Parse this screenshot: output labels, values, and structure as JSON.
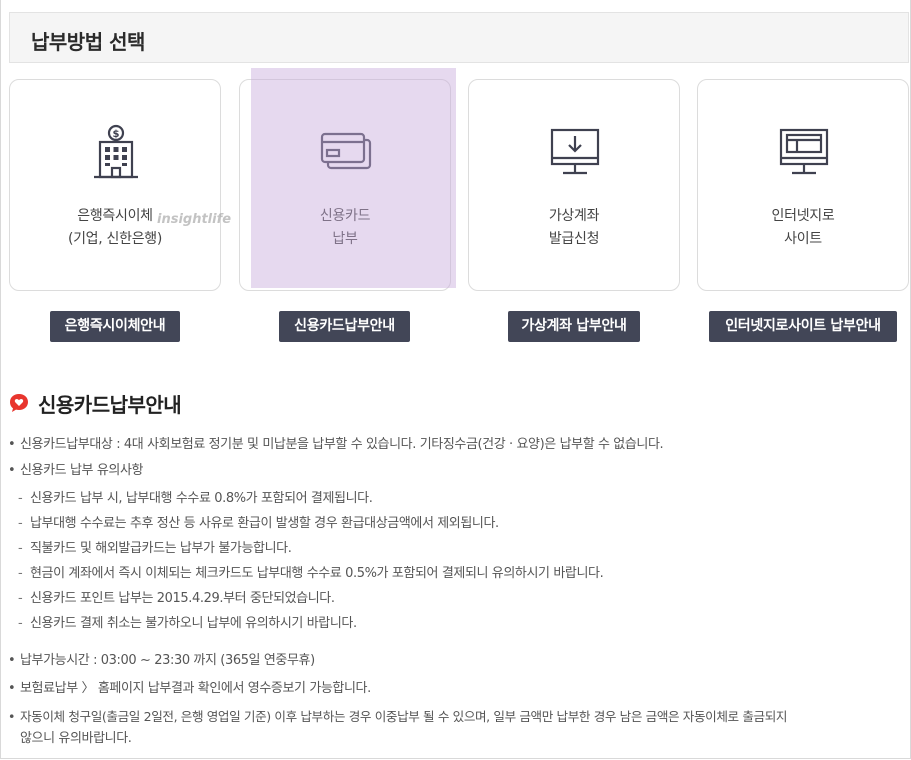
{
  "header": {
    "title": "납부방법 선택"
  },
  "cards": [
    {
      "line1": "은행즉시이체",
      "line2": "(기업, 신한은행)",
      "icon": "bank-building-icon"
    },
    {
      "line1": "신용카드",
      "line2": "납부",
      "icon": "credit-card-icon"
    },
    {
      "line1": "가상계좌",
      "line2": "발급신청",
      "icon": "monitor-download-icon"
    },
    {
      "line1": "인터넷지로",
      "line2": "사이트",
      "icon": "monitor-web-icon"
    }
  ],
  "buttons": {
    "bank": "은행즉시이체안내",
    "card": "신용카드납부안내",
    "virtual": "가상계좌 납부안내",
    "giro": "인터넷지로사이트 납부안내"
  },
  "watermark": "insightlife",
  "section": {
    "title": "신용카드납부안내",
    "icon": "speech-heart-icon",
    "accent": "#e8352e"
  },
  "info": {
    "target": "신용카드납부대상 : 4대 사회보험료 정기분 및 미납분을 납부할 수 있습니다. 기타징수금(건강 · 요양)은 납부할 수 없습니다.",
    "notes_title": "신용카드 납부 유의사항",
    "notes": [
      "신용카드 납부 시, 납부대행 수수료 0.8%가 포함되어 결제됩니다.",
      "납부대행 수수료는 추후 정산 등 사유로 환급이 발생할 경우 환급대상금액에서 제외됩니다.",
      "직불카드 및 해외발급카드는 납부가 불가능합니다.",
      "현금이 계좌에서 즉시 이체되는 체크카드도 납부대행 수수료 0.5%가 포함되어 결제되니 유의하시기 바랍니다.",
      "신용카드 포인트 납부는 2015.4.29.부터 중단되었습니다.",
      "신용카드 결제 취소는 불가하오니 납부에 유의하시기 바랍니다."
    ],
    "hours": "납부가능시간 : 03:00 ~ 23:30 까지 (365일 연중무휴)",
    "receipt": "보험료납부 〉 홈페이지 납부결과 확인에서 영수증보기 가능합니다.",
    "auto_line1": "자동이체 청구일(출금일 2일전, 은행 영업일 기준) 이후 납부하는 경우 이중납부 될 수 있으며, 일부 금액만 납부한 경우 남은 금액은 자동이체로 출금되지",
    "auto_line2": "않으니 유의바랍니다."
  }
}
